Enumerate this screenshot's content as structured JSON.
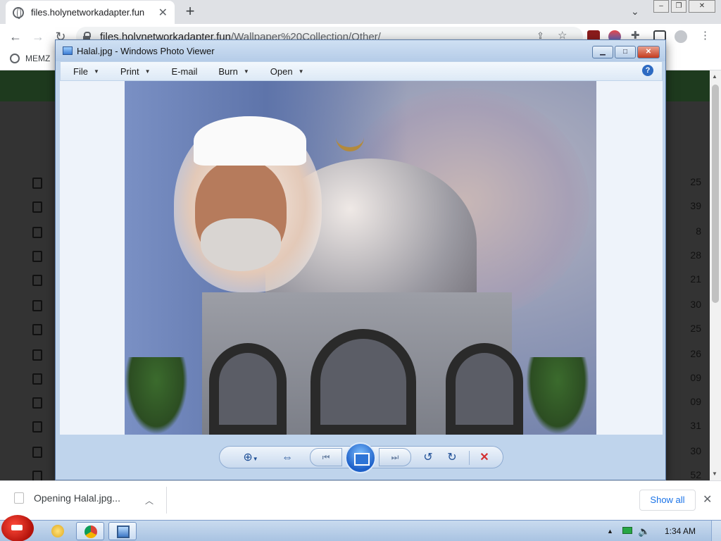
{
  "browser": {
    "tab_title": "files.holynetworkadapter.fun",
    "url_host": "files.holynetworkadapter.fun",
    "url_path": "/Wallpaper%20Collection/Other/",
    "bookmark_label": "MEMZ",
    "window_controls": [
      "minimize",
      "restore",
      "close"
    ]
  },
  "page": {
    "file_numbers": [
      "25",
      "39",
      "8",
      "28",
      "21",
      "30",
      "25",
      "26",
      "09",
      "09",
      "31",
      "30",
      "52"
    ]
  },
  "photo_viewer": {
    "title": "Halal.jpg - Windows Photo Viewer",
    "menu": [
      {
        "label": "File",
        "has_dropdown": true
      },
      {
        "label": "Print",
        "has_dropdown": true
      },
      {
        "label": "E-mail",
        "has_dropdown": false
      },
      {
        "label": "Burn",
        "has_dropdown": true
      },
      {
        "label": "Open",
        "has_dropdown": true
      }
    ],
    "help_glyph": "?",
    "controls": [
      "zoom-icon",
      "actual-size-icon",
      "previous-icon",
      "slideshow-icon",
      "next-icon",
      "rotate-counterclockwise-icon",
      "rotate-clockwise-icon",
      "delete-icon"
    ]
  },
  "downloads": {
    "item_text": "Opening Halal.jpg...",
    "show_all": "Show all"
  },
  "taskbar": {
    "clock": "1:34 AM"
  },
  "colors": {
    "site_header": "#1e3a1e",
    "viewer_frame": "#bfd4ec",
    "link_blue": "#1a73e8",
    "delete_red": "#d32f2f"
  }
}
